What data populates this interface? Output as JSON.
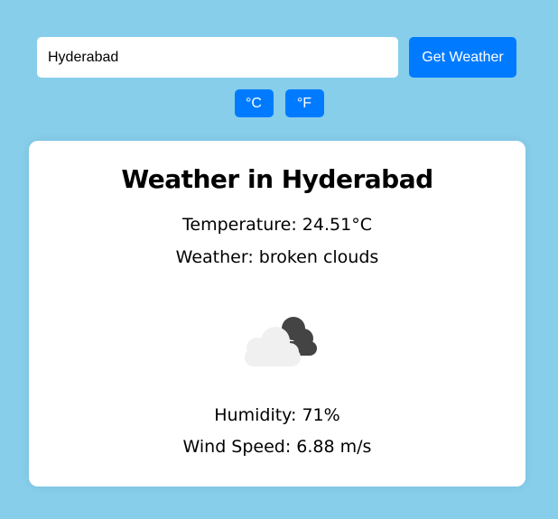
{
  "search": {
    "value": "Hyderabad",
    "button_label": "Get Weather"
  },
  "units": {
    "celsius_label": "°C",
    "fahrenheit_label": "°F"
  },
  "weather": {
    "title": "Weather in Hyderabad",
    "temperature": "Temperature: 24.51°C",
    "description": "Weather: broken clouds",
    "icon": "broken-clouds-icon",
    "humidity": "Humidity: 71%",
    "wind": "Wind Speed: 6.88 m/s"
  },
  "colors": {
    "background": "#87ceeb",
    "accent": "#007bff",
    "card": "#ffffff"
  }
}
